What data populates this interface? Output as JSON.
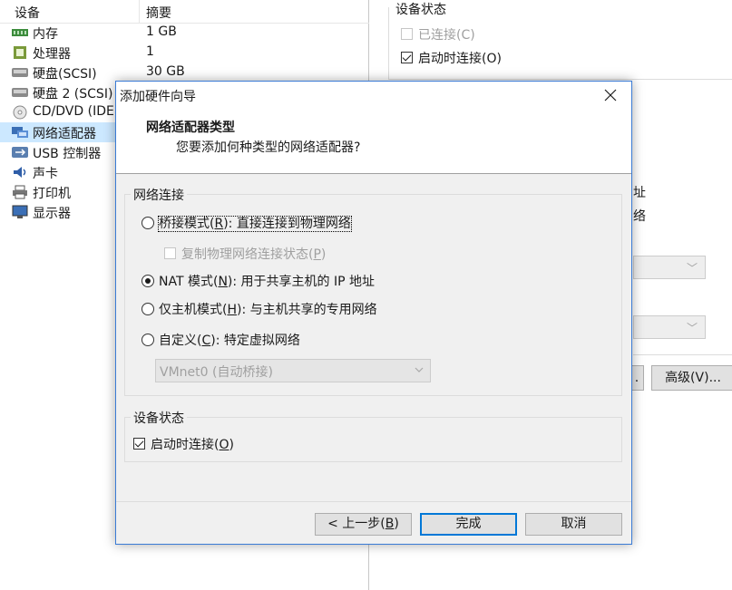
{
  "device_list": {
    "col_device": "设备",
    "col_summary": "摘要",
    "rows": [
      {
        "name": "内存",
        "summary": "1 GB",
        "icon": "memory-icon"
      },
      {
        "name": "处理器",
        "summary": "1",
        "icon": "processor-icon"
      },
      {
        "name": "硬盘(SCSI)",
        "summary": "30 GB",
        "icon": "hard-disk-icon"
      },
      {
        "name": "硬盘 2 (SCSI)",
        "summary": "",
        "icon": "hard-disk-icon"
      },
      {
        "name": "CD/DVD (IDE)",
        "summary": "",
        "icon": "cd-dvd-icon"
      },
      {
        "name": "网络适配器",
        "summary": "",
        "icon": "network-adapter-icon",
        "selected": true
      },
      {
        "name": "USB 控制器",
        "summary": "",
        "icon": "usb-icon"
      },
      {
        "name": "声卡",
        "summary": "",
        "icon": "sound-card-icon"
      },
      {
        "name": "打印机",
        "summary": "",
        "icon": "printer-icon"
      },
      {
        "name": "显示器",
        "summary": "",
        "icon": "display-icon"
      }
    ]
  },
  "settings_pane": {
    "device_status_title": "设备状态",
    "connected_label": "已连接(C)",
    "connect_at_power_on_label": "启动时连接(O)",
    "partial_text_1": "址",
    "partial_text_2": "络",
    "advanced_button": "高级(V)..."
  },
  "dialog": {
    "title": "添加硬件向导",
    "heading": "网络适配器类型",
    "subheading": "您要添加何种类型的网络适配器?",
    "network_group_title": "网络连接",
    "options": {
      "bridged": {
        "pre": "桥接模式(",
        "key": "R",
        "post": "): 直接连接到物理网络"
      },
      "replicate": {
        "pre": "复制物理网络连接状态(",
        "key": "P",
        "post": ")"
      },
      "nat": {
        "pre": "NAT 模式(",
        "key": "N",
        "post": "): 用于共享主机的 IP 地址"
      },
      "host_only": {
        "pre": "仅主机模式(",
        "key": "H",
        "post": "): 与主机共享的专用网络"
      },
      "custom": {
        "pre": "自定义(",
        "key": "C",
        "post": "): 特定虚拟网络"
      }
    },
    "selected_option": "nat",
    "vmnet_value": "VMnet0 (自动桥接)",
    "device_status_title": "设备状态",
    "connect_at_power_on": {
      "pre": "启动时连接(",
      "key": "O",
      "post": ")"
    },
    "buttons": {
      "back_pre": "< 上一步(",
      "back_key": "B",
      "back_post": ")",
      "finish": "完成",
      "cancel": "取消"
    }
  },
  "colors": {
    "accent": "#0078d7",
    "selection": "#cce8ff",
    "dialog_bg": "#f0f0f0"
  }
}
